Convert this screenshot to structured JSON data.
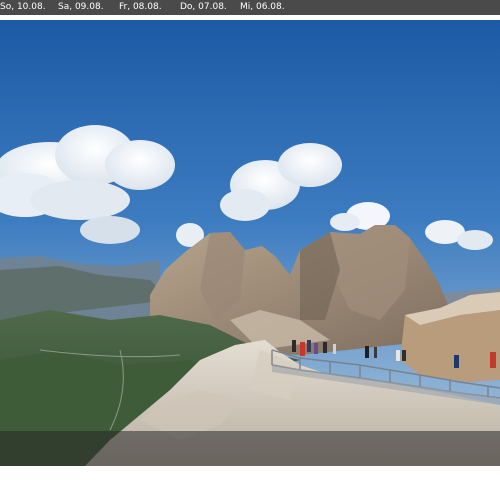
{
  "date_tabs": [
    "So, 10.08.",
    "Sa, 09.08.",
    "Fr, 08.08.",
    "Do, 07.08.",
    "Mi, 06.08."
  ],
  "colors": {
    "tab_bar": "#4a4a4a",
    "tab_text": "#ffffff",
    "sky_top": "#1f5fa8",
    "sky_bottom": "#8fb3d6"
  },
  "webcam": {
    "scene": "mountain-panorama",
    "features": [
      "clouds",
      "rocky-peaks",
      "valley",
      "viewing-platform",
      "railing",
      "visitors"
    ]
  }
}
